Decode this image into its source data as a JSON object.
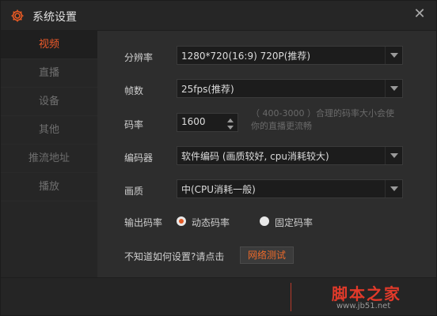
{
  "window": {
    "title": "系统设置",
    "close_glyph": "✕",
    "title_icon": "gear-icon",
    "accent_color": "#ee5a2a"
  },
  "sidebar": {
    "items": [
      {
        "label": "视频",
        "active": true
      },
      {
        "label": "直播",
        "active": false
      },
      {
        "label": "设备",
        "active": false
      },
      {
        "label": "其他",
        "active": false
      },
      {
        "label": "推流地址",
        "active": false
      },
      {
        "label": "播放",
        "active": false
      }
    ]
  },
  "video": {
    "resolution": {
      "label": "分辨率",
      "value": "1280*720(16:9) 720P(推荐)"
    },
    "fps": {
      "label": "帧数",
      "value": "25fps(推荐)"
    },
    "bitrate": {
      "label": "码率",
      "value": "1600",
      "hint": "（ 400-3000 ）合理的码率大小会使你的直播更流畅"
    },
    "encoder": {
      "label": "编码器",
      "value": "软件编码 (画质较好, cpu消耗较大)"
    },
    "quality": {
      "label": "画质",
      "value": "中(CPU消耗一般)"
    },
    "output_bitrate": {
      "label": "输出码率",
      "options": [
        {
          "label": "动态码率",
          "checked": true
        },
        {
          "label": "固定码率",
          "checked": false
        }
      ]
    },
    "help": {
      "text": "不知道如何设置?请点击",
      "button": "网络测试"
    }
  },
  "footer": {
    "watermark_cn": "脚本之家",
    "watermark_url": "www.jb51.net"
  }
}
